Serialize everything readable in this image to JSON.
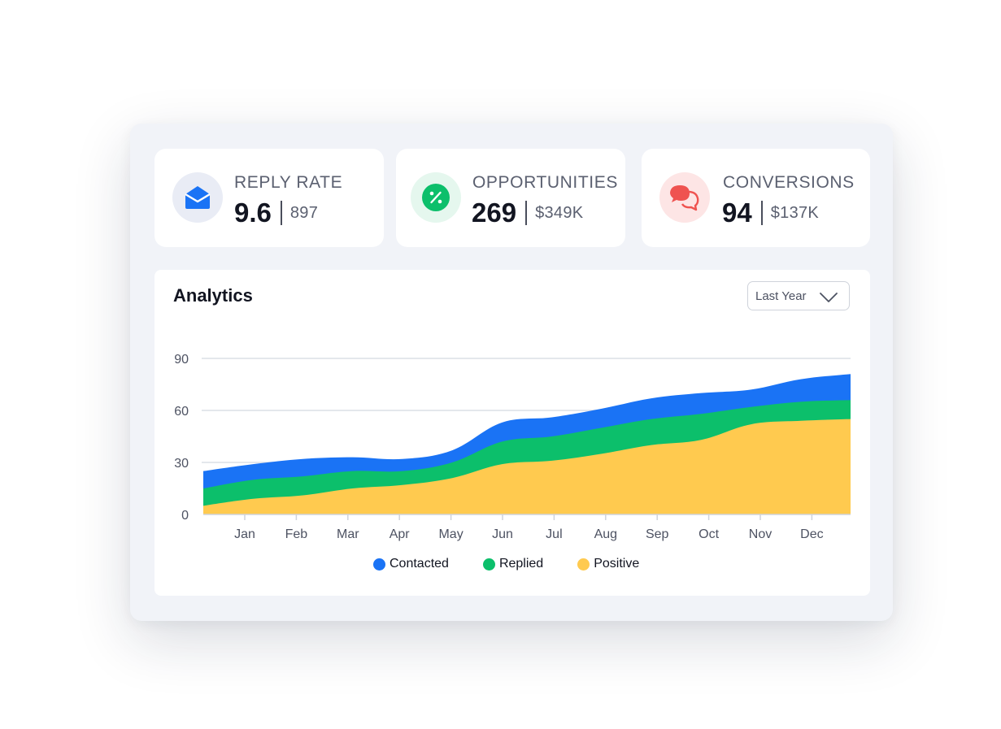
{
  "stats": [
    {
      "label": "REPLY RATE",
      "value": "9.6",
      "sub": "897",
      "icon": "envelope-icon",
      "icon_color": "#1a73f5",
      "icon_bg": "#e9ecf5"
    },
    {
      "label": "OPPORTUNITIES",
      "value": "269",
      "sub": "$349K",
      "icon": "percent-badge-icon",
      "icon_color": "#0cbf6b",
      "icon_bg": "#e5f7ee"
    },
    {
      "label": "CONVERSIONS",
      "value": "94",
      "sub": "$137K",
      "icon": "chat-bubbles-icon",
      "icon_color": "#ef5350",
      "icon_bg": "#fde5e5"
    }
  ],
  "analytics": {
    "title": "Analytics",
    "period": "Last Year"
  },
  "chart_data": {
    "type": "area",
    "stacked": false,
    "categories": [
      "Jan",
      "Feb",
      "Mar",
      "Apr",
      "May",
      "Jun",
      "Jul",
      "Aug",
      "Sep",
      "Oct",
      "Nov",
      "Dec"
    ],
    "ylim": [
      0,
      90
    ],
    "yticks": [
      0,
      30,
      60,
      90
    ],
    "grid": true,
    "legend_position": "bottom",
    "series": [
      {
        "name": "Contacted",
        "color": "#1a73f5",
        "values": [
          25,
          29,
          32,
          33,
          32,
          37,
          53,
          56,
          61,
          67,
          70,
          72,
          78,
          81
        ]
      },
      {
        "name": "Replied",
        "color": "#0cbf6b",
        "values": [
          15,
          20,
          22,
          25,
          25,
          30,
          42,
          45,
          50,
          55,
          58,
          62,
          65,
          66
        ]
      },
      {
        "name": "Positive",
        "color": "#ffca4f",
        "values": [
          5,
          9,
          11,
          15,
          17,
          21,
          29,
          31,
          35,
          40,
          43,
          52,
          54,
          55
        ]
      }
    ]
  }
}
